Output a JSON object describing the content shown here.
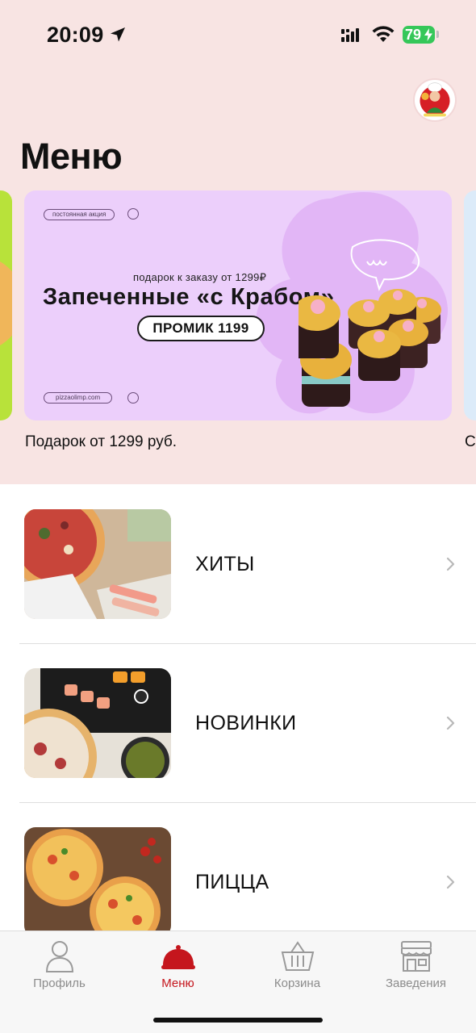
{
  "status_bar": {
    "time": "20:09",
    "battery": "79",
    "battery_color": "#35c759"
  },
  "header": {
    "title": "Меню",
    "logo_icon": "pizzaolimp-chef-logo"
  },
  "banner": {
    "tag": "постоянная акция",
    "gift_line": "подарок к заказу от 1299₽",
    "headline": "Запеченные «с Крабом»",
    "promo_code": "ПРОМИК 1199",
    "site": "pizzaolimp.com",
    "caption": "Подарок от 1299 руб.",
    "next_caption": "Ст",
    "background": "#eccffb"
  },
  "categories": [
    {
      "label": "ХИТЫ",
      "icon": "chevron-right-icon"
    },
    {
      "label": "НОВИНКИ",
      "icon": "chevron-right-icon"
    },
    {
      "label": "ПИЦЦА",
      "icon": "chevron-right-icon"
    }
  ],
  "tabbar": {
    "accent": "#c5161d",
    "items": [
      {
        "label": "Профиль",
        "icon": "person-icon"
      },
      {
        "label": "Меню",
        "icon": "cloche-icon",
        "active": true
      },
      {
        "label": "Корзина",
        "icon": "basket-icon"
      },
      {
        "label": "Заведения",
        "icon": "storefront-icon"
      }
    ]
  }
}
